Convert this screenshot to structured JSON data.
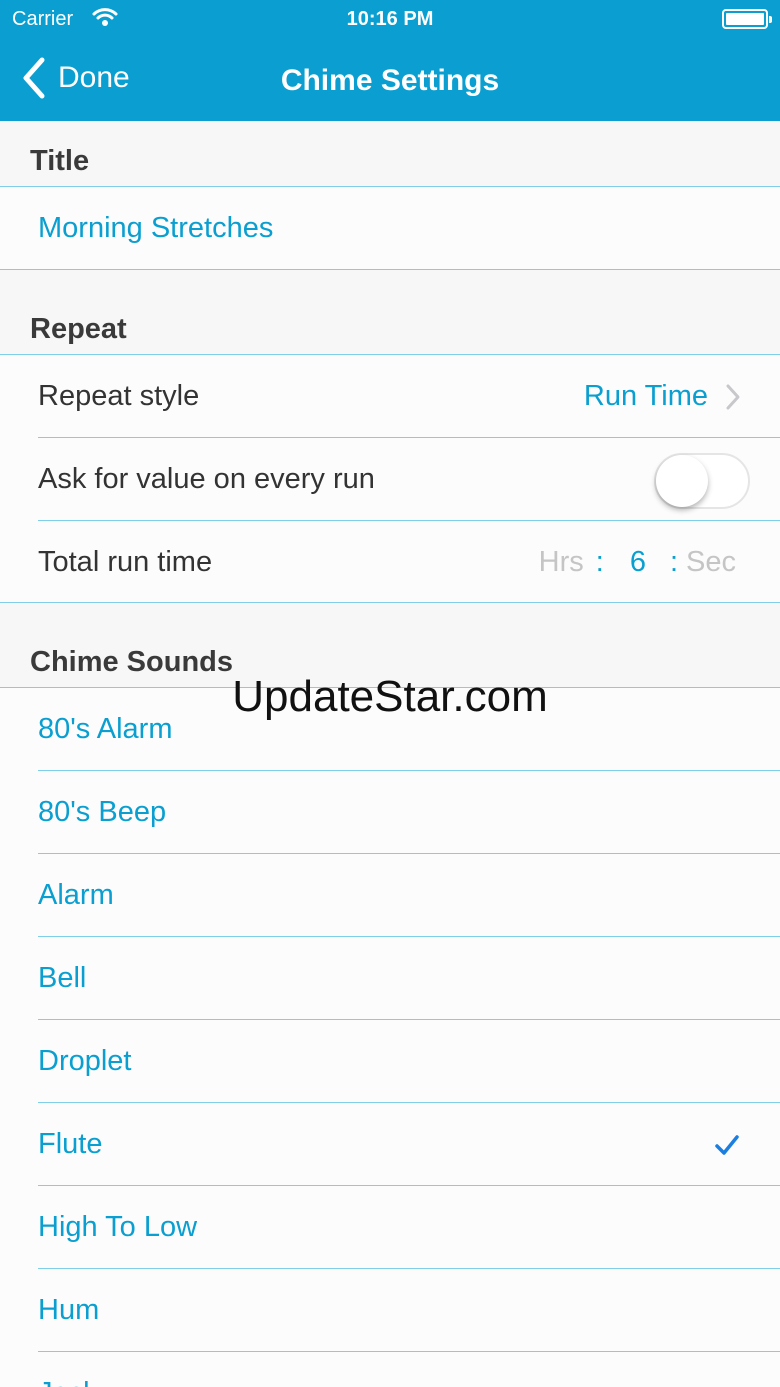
{
  "status_bar": {
    "carrier": "Carrier",
    "time": "10:16 PM"
  },
  "nav": {
    "back_label": "Done",
    "title": "Chime Settings"
  },
  "sections": {
    "title": {
      "header": "Title",
      "value": "Morning Stretches"
    },
    "repeat": {
      "header": "Repeat",
      "repeat_style_label": "Repeat style",
      "repeat_style_value": "Run Time",
      "ask_label": "Ask for value on every run",
      "ask_toggle_on": false,
      "total_label": "Total run time",
      "picker": {
        "hrs": "Hrs",
        "sep1": ":",
        "value": "6",
        "sep2": ":",
        "sec": "Sec"
      }
    },
    "chime_sounds": {
      "header": "Chime Sounds",
      "items": [
        {
          "label": "80's Alarm"
        },
        {
          "label": "80's Beep"
        },
        {
          "label": "Alarm"
        },
        {
          "label": "Bell"
        },
        {
          "label": "Droplet"
        },
        {
          "label": "Flute",
          "selected": true
        },
        {
          "label": "High To Low"
        },
        {
          "label": "Hum"
        },
        {
          "label": "Jack"
        }
      ]
    }
  },
  "watermark": "UpdateStar.com",
  "colors": {
    "accent": "#0a9fd0",
    "header_text": "#3a3a3a",
    "check": "#1a7fe0"
  }
}
